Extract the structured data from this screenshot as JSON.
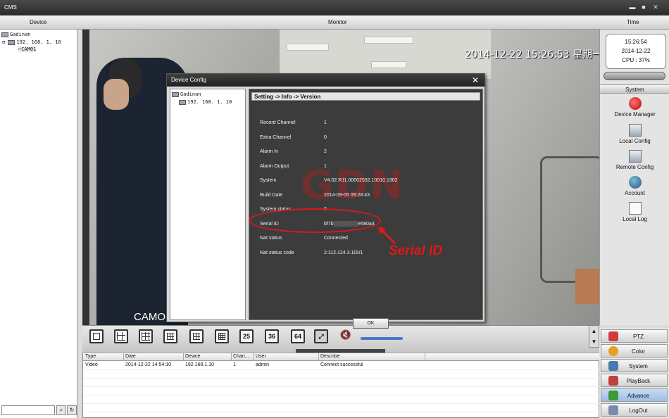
{
  "app": {
    "title": "CMS"
  },
  "header": {
    "device_label": "Device",
    "monitor_label": "Monitor",
    "time_label": "Time"
  },
  "tree": {
    "root": "Gadinan",
    "device": "192. 168. 1. 10",
    "camera": "CAM01"
  },
  "video": {
    "osd_timestamp": "2014-12-22 15:26:53 星期一",
    "cam_label": "CAMO"
  },
  "clock": {
    "time": "15:26:54",
    "date": "2014-12-22",
    "cpu": "CPU : 37%"
  },
  "system_panel": {
    "title": "System",
    "items": [
      {
        "label": "Device Manager",
        "icon": "device-manager-icon"
      },
      {
        "label": "Local Config",
        "icon": "local-config-icon"
      },
      {
        "label": "Remote Config",
        "icon": "remote-config-icon"
      },
      {
        "label": "Account",
        "icon": "account-icon"
      },
      {
        "label": "Local Log",
        "icon": "local-log-icon"
      }
    ]
  },
  "toolbar": {
    "layouts": [
      "1",
      "4",
      "6",
      "9",
      "12",
      "16",
      "25",
      "36",
      "64"
    ],
    "volume": 0.7
  },
  "log": {
    "columns": [
      "Type",
      "Date",
      "Device",
      "Chan...",
      "User",
      "Describe"
    ],
    "rows": [
      [
        "Video",
        "2014-12-22 14:54:10",
        "192.168.1.10",
        "1",
        "admin",
        "Connect successful"
      ]
    ]
  },
  "menu": {
    "items": [
      {
        "label": "PTZ",
        "icon": "ptz-icon",
        "color": "#d23b3b"
      },
      {
        "label": "Color",
        "icon": "color-icon",
        "color": "#e8a020"
      },
      {
        "label": "System",
        "icon": "system-icon",
        "color": "#4a7ab0"
      },
      {
        "label": "PlayBack",
        "icon": "playback-icon",
        "color": "#c04040"
      },
      {
        "label": "Advance",
        "icon": "advance-icon",
        "color": "#3a9a3a",
        "active": true
      },
      {
        "label": "LogOut",
        "icon": "logout-icon",
        "color": "#7a8aa8"
      }
    ]
  },
  "dialog": {
    "title": "Device Config",
    "tree_root": "Gadinan",
    "tree_device": "192. 168. 1. 10",
    "breadcrumb": "Setting -> Info -> Version",
    "watermark": "GDN",
    "rows": [
      {
        "label": "Record Channel",
        "value": "1"
      },
      {
        "label": "Extra Channel",
        "value": "0"
      },
      {
        "label": "Alarm In",
        "value": "2"
      },
      {
        "label": "Alarm Output",
        "value": "1"
      },
      {
        "label": "System",
        "value": "V4.02.R11.00002532.10010.1302"
      },
      {
        "label": "Build Date",
        "value": "2014-09-05 09:28:43"
      },
      {
        "label": "System status",
        "value": "0"
      },
      {
        "label": "Serial ID",
        "value": "bf7b░░░░░░░e580a3"
      },
      {
        "label": "Nat status",
        "value": "Connected"
      },
      {
        "label": "Nat status code",
        "value": "2:112.124.3.115/1"
      }
    ],
    "ok_label": "OK"
  },
  "annotation": {
    "label": "Serial ID",
    "color": "#e01818"
  }
}
